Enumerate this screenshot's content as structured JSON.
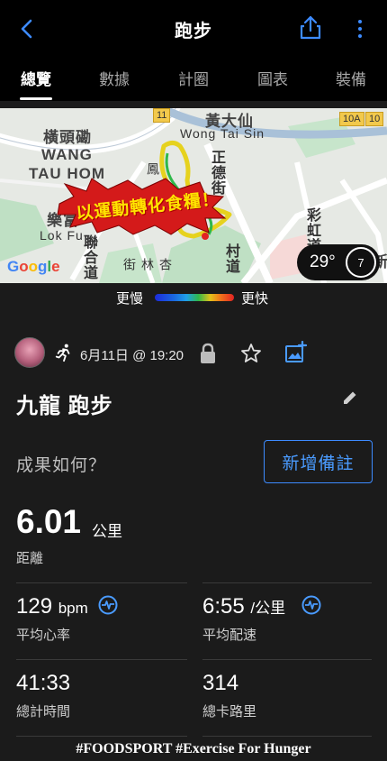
{
  "header": {
    "title": "跑步",
    "back_icon": "chevron-left-icon",
    "share_icon": "share-icon",
    "more_icon": "more-vertical-icon"
  },
  "tabs": [
    {
      "label": "總覽",
      "active": true
    },
    {
      "label": "數據",
      "active": false
    },
    {
      "label": "計圈",
      "active": false
    },
    {
      "label": "圖表",
      "active": false
    },
    {
      "label": "裝備",
      "active": false
    }
  ],
  "map": {
    "labels": {
      "area1_cn": "橫頭磡",
      "area1_en_1": "WANG",
      "area1_en_2": "TAU HOM",
      "area2_cn": "樂富",
      "area2_en": "Lok Fu",
      "area3_cn": "黃大仙",
      "area3_en": "Wong Tai Sin",
      "road1": "正德街",
      "road2": "彩虹道",
      "road3": "聯合道",
      "road4": "杏林街",
      "road5": "村道",
      "road6": "鳳",
      "route_11": "11",
      "route_10a": "10A",
      "route_10": "10",
      "tail": "新",
      "banner": "以運動轉化食糧！"
    },
    "google_logo": "Google",
    "weather_temp": "29°",
    "wind_speed": "7",
    "colors": {
      "route_fast": "#e6d21e",
      "route_slow": "#2fb84a"
    }
  },
  "speed_legend": {
    "slow": "更慢",
    "fast": "更快"
  },
  "meta": {
    "date": "6月11日 @ 19:20",
    "avatar": "avatar",
    "run_icon": "running-person-icon",
    "lock_icon": "lock-icon",
    "star_icon": "star-outline-icon",
    "photo_icon": "add-photo-icon"
  },
  "activity": {
    "name": "九龍 跑步",
    "edit_icon": "pencil-icon"
  },
  "feeling": {
    "label": "成果如何？",
    "add_note": "新增備註"
  },
  "stats": {
    "distance": {
      "value": "6.01",
      "unit": "公里",
      "label": "距離"
    },
    "heart_rate": {
      "value": "129",
      "unit": "bpm",
      "label": "平均心率"
    },
    "pace": {
      "value": "6:55",
      "unit": "/公里",
      "label": "平均配速"
    },
    "time": {
      "value": "41:33",
      "label": "總計時間"
    },
    "calories": {
      "value": "314",
      "label": "總卡路里"
    }
  },
  "footer": {
    "hashtag": "#FOODSPORT #Exercise For Hunger"
  },
  "colors": {
    "accent": "#3d8bff",
    "background": "#1b1b1b",
    "header": "#000000"
  }
}
